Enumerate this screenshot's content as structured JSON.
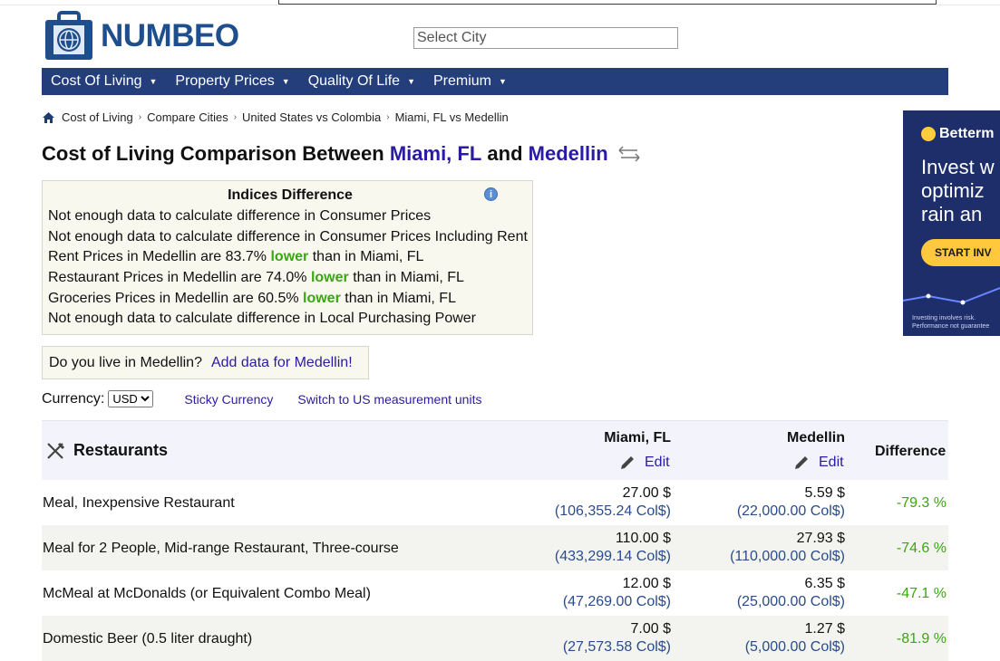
{
  "brand": {
    "name": "NUMBEO"
  },
  "search": {
    "placeholder": "Select City"
  },
  "nav": {
    "items": [
      {
        "label": "Cost Of Living"
      },
      {
        "label": "Property Prices"
      },
      {
        "label": "Quality Of Life"
      },
      {
        "label": "Premium"
      }
    ]
  },
  "breadcrumb": {
    "items": [
      "Cost of Living",
      "Compare Cities",
      "United States vs Colombia",
      "Miami, FL vs Medellin"
    ]
  },
  "title": {
    "prefix": "Cost of Living Comparison Between",
    "city1": "Miami, FL",
    "connector": "and",
    "city2": "Medellin"
  },
  "indices": {
    "heading": "Indices Difference",
    "line1": "Not enough data to calculate difference in Consumer Prices",
    "line2": "Not enough data to calculate difference in Consumer Prices Including Rent",
    "line3": {
      "pre": "Rent Prices in Medellin are 83.7%",
      "word": "lower",
      "post": "than in Miami, FL"
    },
    "line4": {
      "pre": "Restaurant Prices in Medellin are 74.0%",
      "word": "lower",
      "post": "than in Miami, FL"
    },
    "line5": {
      "pre": "Groceries Prices in Medellin are 60.5%",
      "word": "lower",
      "post": "than in Miami, FL"
    },
    "line6": "Not enough data to calculate difference in Local Purchasing Power"
  },
  "live": {
    "question": "Do you live in Medellin?",
    "link": "Add data for Medellin!"
  },
  "currency": {
    "label": "Currency:",
    "selected": "USD",
    "sticky": "Sticky Currency",
    "switch_units": "Switch to US measurement units"
  },
  "table": {
    "category": "Restaurants",
    "col1": "Miami, FL",
    "col2": "Medellin",
    "edit": "Edit",
    "diff_header": "Difference",
    "rows": [
      {
        "item": "Meal, Inexpensive Restaurant",
        "v1": "27.00 $",
        "v1_local": "(106,355.24 Col$)",
        "v2": "5.59 $",
        "v2_local": "(22,000.00 Col$)",
        "diff": "-79.3 %"
      },
      {
        "item": "Meal for 2 People, Mid-range Restaurant, Three-course",
        "v1": "110.00 $",
        "v1_local": "(433,299.14 Col$)",
        "v2": "27.93 $",
        "v2_local": "(110,000.00 Col$)",
        "diff": "-74.6 %"
      },
      {
        "item": "McMeal at McDonalds (or Equivalent Combo Meal)",
        "v1": "12.00 $",
        "v1_local": "(47,269.00 Col$)",
        "v2": "6.35 $",
        "v2_local": "(25,000.00 Col$)",
        "diff": "-47.1 %"
      },
      {
        "item": "Domestic Beer (0.5 liter draught)",
        "v1": "7.00 $",
        "v1_local": "(27,573.58 Col$)",
        "v2": "1.27 $",
        "v2_local": "(5,000.00 Col$)",
        "diff": "-81.9 %"
      }
    ]
  },
  "ad": {
    "brand": "Betterm",
    "copy1": "Invest w",
    "copy2": "optimiz",
    "copy3": "rain an",
    "cta": "START INV",
    "disclaimer1": "Investing involves risk.",
    "disclaimer2": "Performance not guarantee"
  },
  "colors": {
    "nav_bg": "#233e7a",
    "link": "#2a1ba3",
    "positive_green": "#3aa612",
    "ad_bg": "#1d2e6a"
  }
}
